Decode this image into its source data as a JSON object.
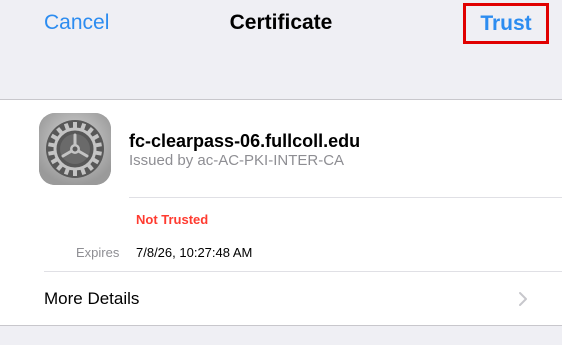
{
  "nav": {
    "cancel_label": "Cancel",
    "title": "Certificate",
    "trust_label": "Trust"
  },
  "certificate": {
    "name": "fc-clearpass-06.fullcoll.edu",
    "issuer": "Issued by ac-AC-PKI-INTER-CA",
    "status": "Not Trusted",
    "expires_label": "Expires",
    "expires_value": "7/8/26, 10:27:48 AM",
    "icon": "settings-gear-icon"
  },
  "more_details": {
    "label": "More Details",
    "icon": "chevron-right-icon"
  },
  "colors": {
    "accent": "#2c8cf0",
    "not_trusted": "#ff3b30",
    "highlight_box": "#e00000"
  }
}
